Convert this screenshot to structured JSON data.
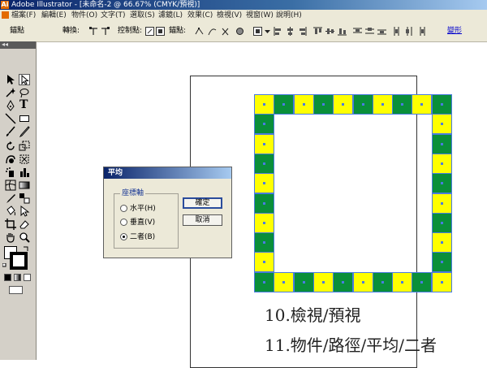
{
  "window": {
    "app_icon_text": "Ai",
    "title": "Adobe Illustrator - [未命名-2 @ 66.67% (CMYK/預視)]"
  },
  "menu": {
    "items": [
      "檔案(F)",
      "編輯(E)",
      "物件(O)",
      "文字(T)",
      "選取(S)",
      "濾鏡(L)",
      "效果(C)",
      "檢視(V)",
      "視窗(W)",
      "說明(H)"
    ]
  },
  "controlbar": {
    "anchor_label": "錨點",
    "convert_label": "轉換:",
    "handles_label": "控制點:",
    "anchors_label": "錨點:",
    "link_label": "變形"
  },
  "toolpanel": {
    "collapse_glyph": "◂◂",
    "type_tool_glyph": "T"
  },
  "canvas": {
    "frame_colors": {
      "yellow": "#ffff00",
      "green": "#0a8f3a",
      "selection": "#4a7be0"
    },
    "notes": [
      "10.檢視/預視",
      "11.物件/路徑/平均/二者"
    ]
  },
  "dialog": {
    "title": "平均",
    "axis_group_label": "座標軸",
    "options": [
      {
        "label": "水平(H)",
        "selected": false
      },
      {
        "label": "垂直(V)",
        "selected": false
      },
      {
        "label": "二者(B)",
        "selected": true
      }
    ],
    "ok_label": "確定",
    "cancel_label": "取消"
  }
}
